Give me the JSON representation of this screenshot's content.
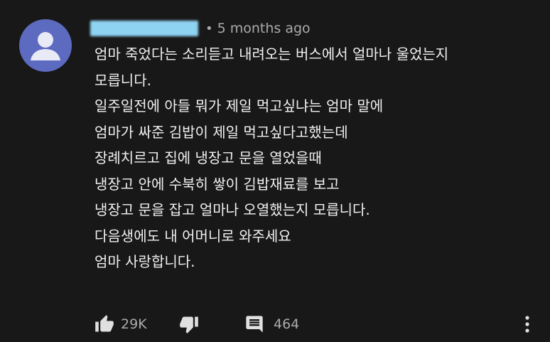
{
  "comment": {
    "timestamp": "5 months ago",
    "lines": [
      "엄마 죽었다는 소리듣고 내려오는 버스에서 얼마나 울었는지",
      "모릅니다.",
      "일주일전에 아들 뭐가 제일 먹고싶냐는 엄마 말에",
      "엄마가 싸준 김밥이 제일 먹고싶다고했는데",
      "장례치르고 집에 냉장고 문을 열었을때",
      "냉장고 안에 수북히 쌓이 김밥재료를 보고",
      "냉장고 문을 잡고 얼마나 오열했는지 모릅니다.",
      "다음생에도 내 어머니로 와주세요",
      "엄마 사랑합니다."
    ],
    "separator": "•"
  },
  "actions": {
    "like_count": "29K",
    "reply_count": "464"
  },
  "icons": {
    "avatar": "default-avatar-icon",
    "like": "thumb-up-icon",
    "dislike": "thumb-down-icon",
    "reply": "comment-icon",
    "more": "more-vertical-icon"
  },
  "colors": {
    "background": "#181818",
    "text": "#f1f1f1",
    "secondary_text": "#aaaaaa",
    "avatar_bg": "#5c6bc0",
    "redaction": "#8fd3f2"
  }
}
